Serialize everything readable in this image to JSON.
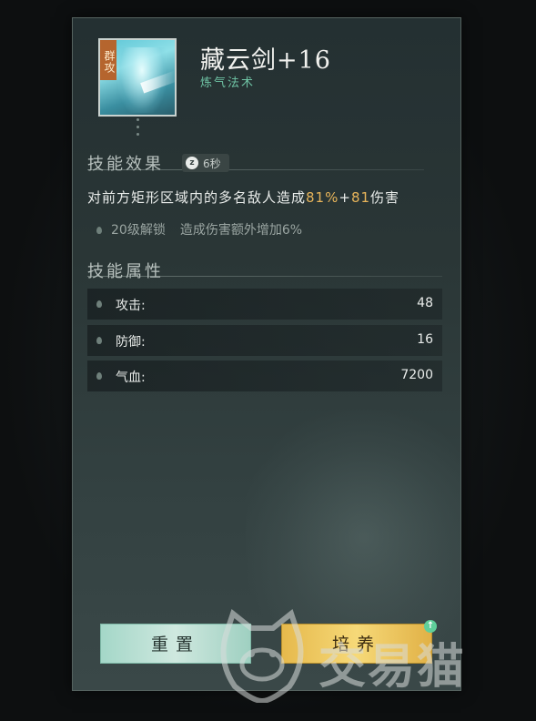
{
  "skill": {
    "tag": "群攻",
    "name": "藏云剑+16",
    "category": "炼气法术"
  },
  "effect": {
    "header": "技能效果",
    "cooldown_icon": "z",
    "cooldown": "6秒",
    "desc_prefix": "对前方矩形区域内的多名敌人造成",
    "desc_pct": "81%",
    "desc_plus": "+",
    "desc_flat": "81",
    "desc_suffix": "伤害",
    "unlock_level": "20级解锁",
    "unlock_text": "造成伤害额外增加6%"
  },
  "attributes": {
    "header": "技能属性",
    "rows": [
      {
        "label": "攻击:",
        "value": "48"
      },
      {
        "label": "防御:",
        "value": "16"
      },
      {
        "label": "气血:",
        "value": "7200"
      }
    ]
  },
  "buttons": {
    "reset": "重置",
    "train": "培养",
    "upgrade_icon": "↑"
  },
  "watermark": {
    "text": "交易猫"
  },
  "colors": {
    "highlight": "#e7b45a",
    "category": "#6fc3a4",
    "train_button": "#f0cc63",
    "reset_button": "#bfe2d6"
  }
}
